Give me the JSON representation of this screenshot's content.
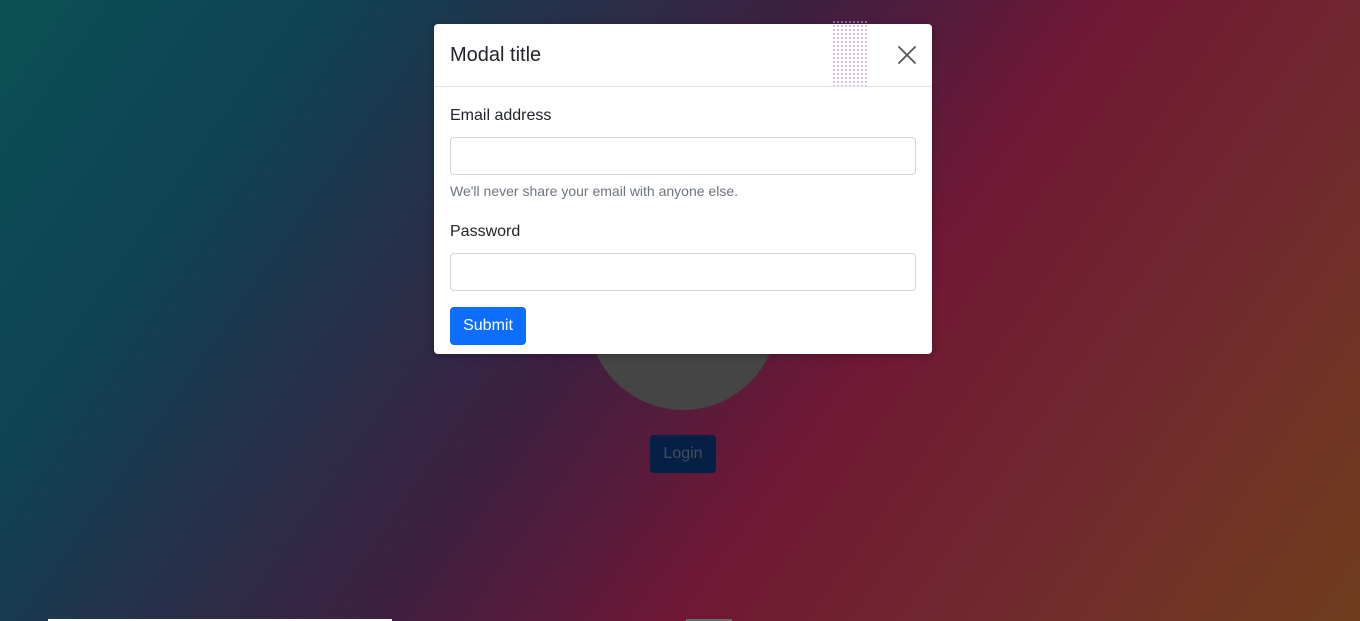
{
  "background_page": {
    "login_button_label": "Login"
  },
  "modal": {
    "title": "Modal title",
    "close_icon": "close-icon",
    "email": {
      "label": "Email address",
      "value": "",
      "help_text": "We'll never share your email with anyone else."
    },
    "password": {
      "label": "Password",
      "value": ""
    },
    "submit_label": "Submit"
  },
  "colors": {
    "primary": "#0d6efd",
    "backdrop_login_button": "#0a3f8a",
    "muted_text": "#6c757d"
  }
}
